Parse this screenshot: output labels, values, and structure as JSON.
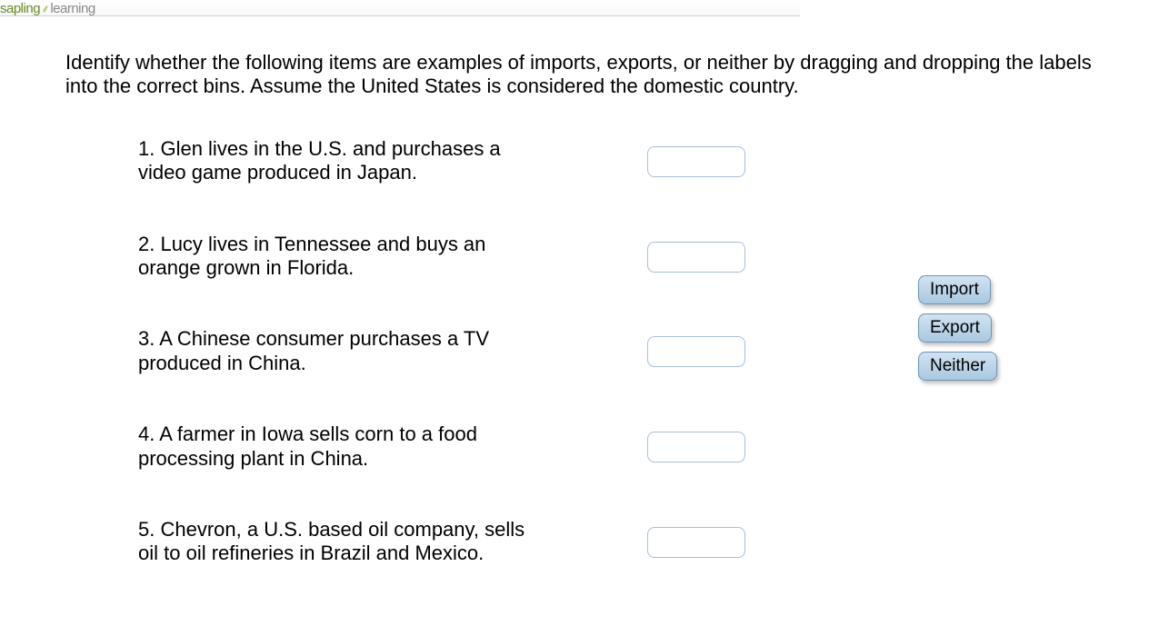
{
  "header": {
    "logo_part1": "sapling",
    "logo_part2": "learning"
  },
  "prompt": "Identify whether the following items are examples of imports, exports, or neither by dragging and dropping the labels into the correct bins. Assume the United States is considered the domestic country.",
  "items": [
    {
      "text": "1. Glen lives in the U.S. and purchases  a video game produced in Japan."
    },
    {
      "text": "2. Lucy lives in Tennessee and buys an orange grown in Florida."
    },
    {
      "text": "3. A Chinese consumer purchases a TV produced in China."
    },
    {
      "text": "4. A farmer in Iowa sells corn to a food processing plant in China."
    },
    {
      "text": "5. Chevron, a U.S. based oil company, sells oil to oil refineries in Brazil and Mexico."
    }
  ],
  "labels": [
    "Import",
    "Export",
    "Neither"
  ]
}
